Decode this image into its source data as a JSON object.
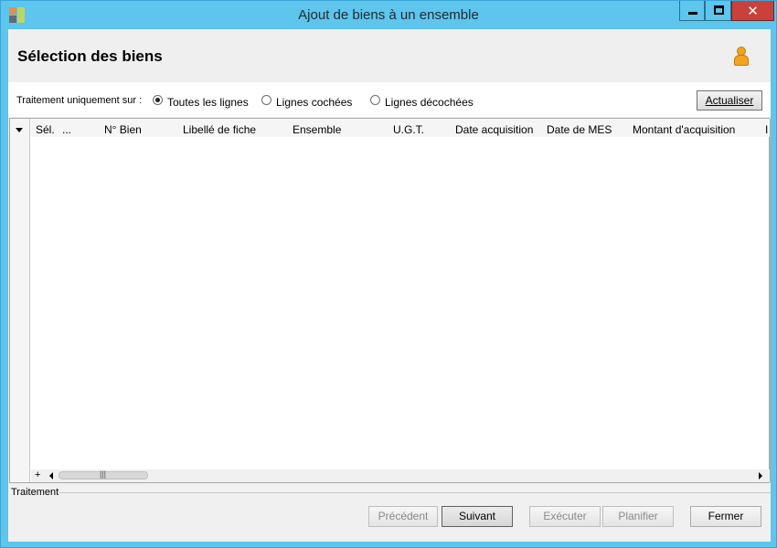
{
  "window": {
    "title": "Ajout de biens à un ensemble",
    "controls": {
      "minimize": "minimize",
      "maximize": "maximize",
      "close": "✕"
    }
  },
  "header": {
    "title": "Sélection des biens",
    "user_icon": "user-icon"
  },
  "filter": {
    "label": "Traitement uniquement sur :",
    "options": [
      {
        "label": "Toutes les lignes",
        "checked": true
      },
      {
        "label": "Lignes cochées",
        "checked": false
      },
      {
        "label": "Lignes décochées",
        "checked": false
      }
    ],
    "refresh_label": "Actualiser"
  },
  "grid": {
    "columns": [
      "Sél.",
      "...",
      "N° Bien",
      "Libellé de fiche",
      "Ensemble",
      "U.G.T.",
      "Date acquisition",
      "Date de MES",
      "Montant d'acquisition",
      "I"
    ],
    "rows": [],
    "add_row": "+",
    "scroll_grip": "|||"
  },
  "footer": {
    "group_label": "Traitement",
    "buttons": {
      "previous": "Précédent",
      "next": "Suivant",
      "execute": "Exécuter",
      "schedule": "Planifier",
      "close": "Fermer"
    }
  },
  "colors": {
    "titlebar": "#5ec5ec",
    "close_button": "#c9413b",
    "user_icon": "#f2a41f"
  }
}
